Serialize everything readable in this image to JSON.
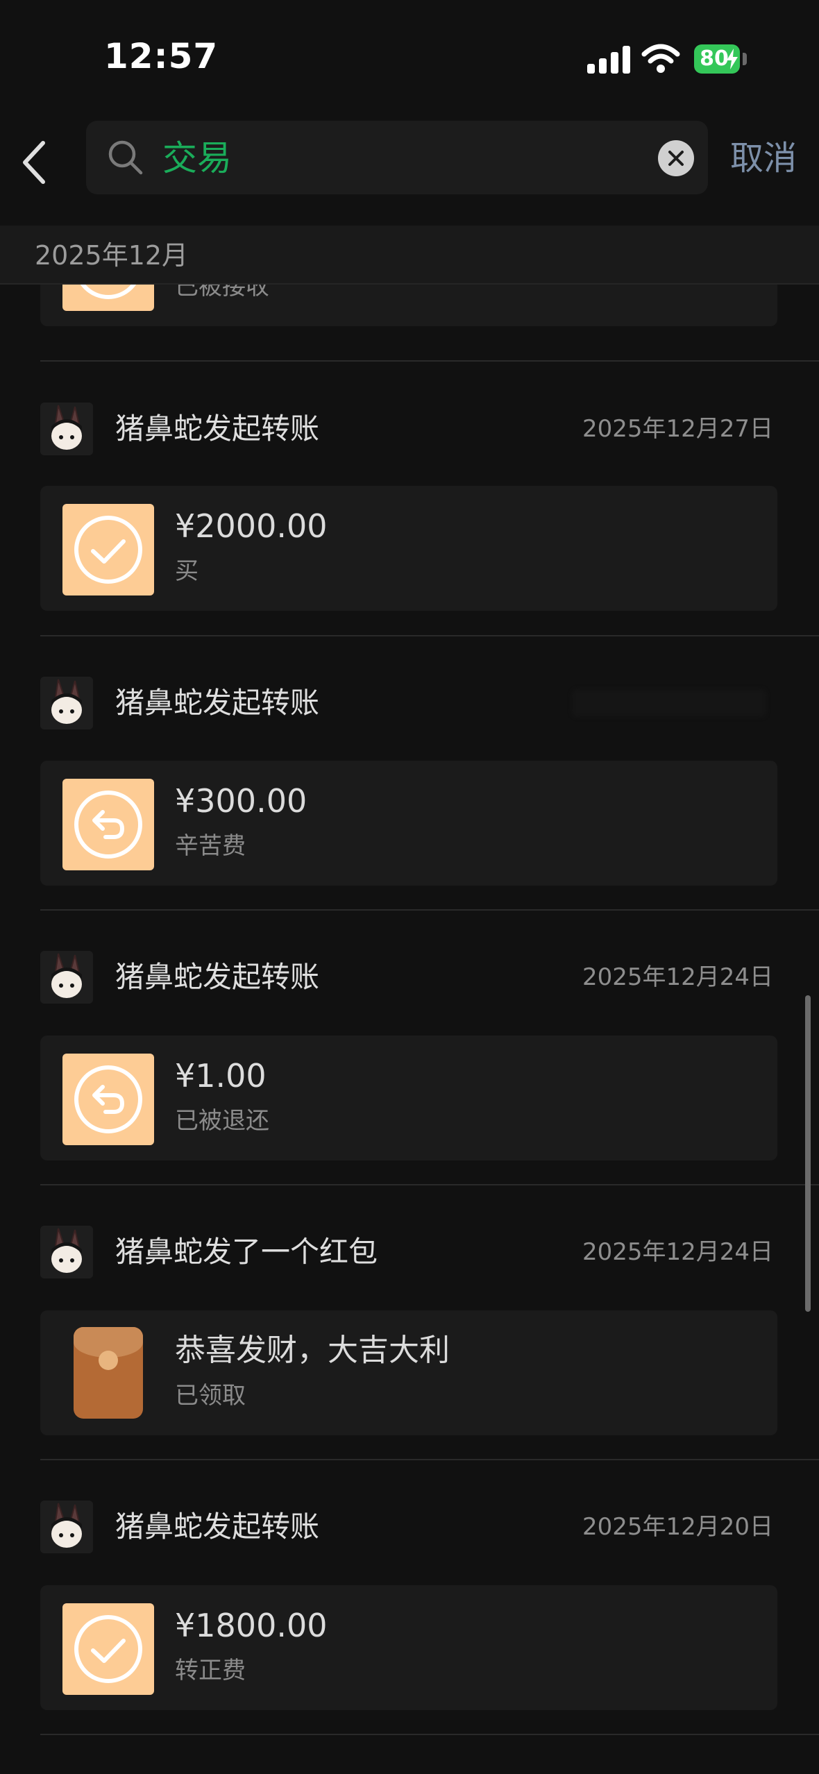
{
  "status_bar": {
    "time": "12:57",
    "battery": "80"
  },
  "search": {
    "query": "交易",
    "cancel_label": "取消"
  },
  "month_header": "2025年12月",
  "partial_item": {
    "note": "已被接收"
  },
  "items": [
    {
      "title": "猪鼻蛇发起转账",
      "date": "2025年12月27日",
      "amount": "¥2000.00",
      "note": "买",
      "icon": "check-circle-icon"
    },
    {
      "title": "猪鼻蛇发起转账",
      "date": "",
      "amount": "¥300.00",
      "note": "辛苦费",
      "icon": "return-arrow-icon"
    },
    {
      "title": "猪鼻蛇发起转账",
      "date": "2025年12月24日",
      "amount": "¥1.00",
      "note": "已被退还",
      "icon": "return-arrow-icon"
    },
    {
      "title": "猪鼻蛇发了一个红包",
      "date": "2025年12月24日",
      "amount": "恭喜发财，大吉大利",
      "note": "已领取",
      "icon": "red-envelope-icon"
    },
    {
      "title": "猪鼻蛇发起转账",
      "date": "2025年12月20日",
      "amount": "¥1800.00",
      "note": "转正费",
      "icon": "check-circle-icon"
    }
  ],
  "colors": {
    "background": "#111111",
    "search_accent": "#1aad5a",
    "cancel_link": "#7d90aa",
    "transfer_icon_bg": "#fdcc95",
    "battery": "#34c759"
  }
}
